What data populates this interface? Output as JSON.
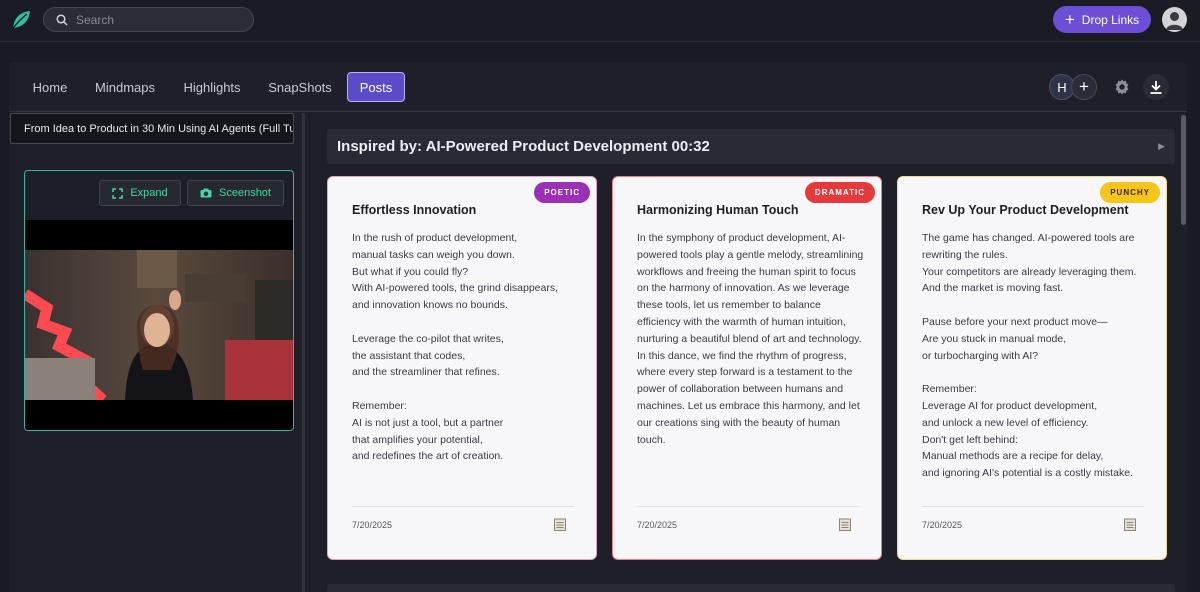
{
  "topbar": {
    "search_placeholder": "Search",
    "drop_links_label": "Drop Links"
  },
  "nav": {
    "tabs": [
      "Home",
      "Mindmaps",
      "Highlights",
      "SnapShots",
      "Posts"
    ],
    "active_tab": "Posts",
    "collaborator_initial": "H"
  },
  "left": {
    "source_title": "From Idea to Product in 30 Min Using AI Agents (Full Tut",
    "expand_label": "Expand",
    "screenshot_label": "Sceenshot"
  },
  "inspired": {
    "title": "Inspired by: AI-Powered Product Development 00:32"
  },
  "posts": [
    {
      "badge": "POETIC",
      "badge_color": "#9b2fb5",
      "border_color": "#e7a3c6",
      "title": "Effortless Innovation",
      "body": "In the rush of product development,\nmanual tasks can weigh you down.\nBut what if you could fly?\nWith AI-powered tools, the grind disappears,\nand innovation knows no bounds.\n\nLeverage the co-pilot that writes,\nthe assistant that codes,\nand the streamliner that refines.\n\nRemember:\nAI is not just a tool, but a partner\nthat amplifies your potential,\nand redefines the art of creation.",
      "date": "7/20/2025"
    },
    {
      "badge": "DRAMATIC",
      "badge_color": "#e5393c",
      "border_color": "#ef7f85",
      "title": "Harmonizing Human Touch",
      "body": "In the symphony of product development, AI-powered tools play a gentle melody, streamlining workflows and freeing the human spirit to focus on the harmony of innovation. As we leverage these tools, let us remember to balance efficiency with the warmth of human intuition, nurturing a beautiful blend of art and technology. In this dance, we find the rhythm of progress, where every step forward is a testament to the power of collaboration between humans and machines. Let us embrace this harmony, and let our creations sing with the beauty of human touch.",
      "date": "7/20/2025"
    },
    {
      "badge": "PUNCHY",
      "badge_color": "#f5c518",
      "border_color": "#f3d88a",
      "title": "Rev Up Your Product Development",
      "body": "The game has changed. AI-powered tools are rewriting the rules.\nYour competitors are already leveraging them.\nAnd the market is moving fast.\n\nPause before your next product move—\nAre you stuck in manual mode,\nor turbocharging with AI?\n\nRemember:\nLeverage AI for product development,\nand unlock a new level of efficiency.\nDon't get left behind:\nManual methods are a recipe for delay,\nand ignoring AI's potential is a costly mistake.",
      "date": "7/20/2025"
    }
  ]
}
